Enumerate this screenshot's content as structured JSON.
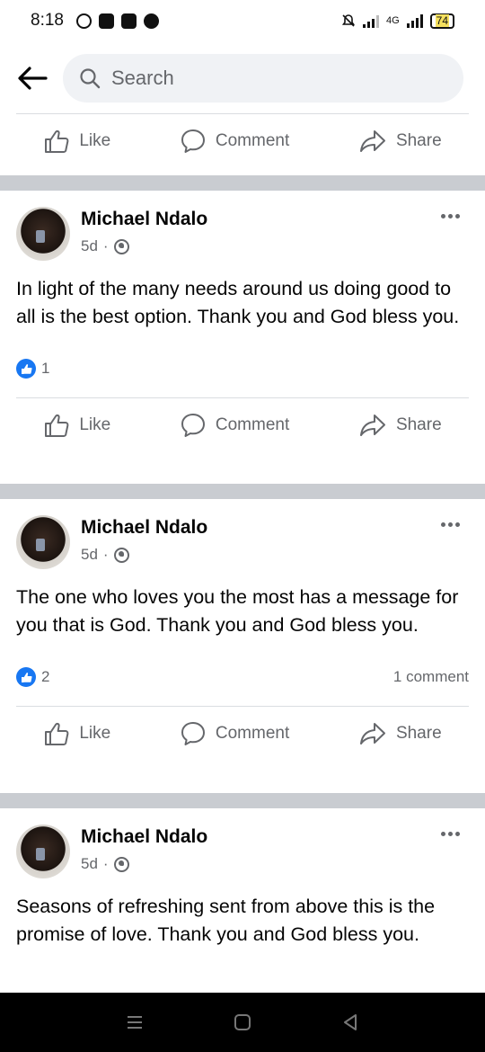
{
  "status": {
    "time": "8:18",
    "network": "4G",
    "battery": "74"
  },
  "search": {
    "placeholder": "Search"
  },
  "actions": {
    "like": "Like",
    "comment": "Comment",
    "share": "Share"
  },
  "posts": [
    {
      "author": "Michael Ndalo",
      "time": "5d",
      "text": "In light of the many needs around us doing good to all is the best option. Thank you and God bless you.",
      "likes": "1",
      "comments": ""
    },
    {
      "author": "Michael Ndalo",
      "time": "5d",
      "text": "The one who loves you the most has a message for you that is God.  Thank you and God bless you.",
      "likes": "2",
      "comments": "1 comment"
    },
    {
      "author": "Michael Ndalo",
      "time": "5d",
      "text": "Seasons of refreshing sent from above this is the promise of love. Thank you and God bless you.",
      "likes": "",
      "comments": ""
    }
  ],
  "icons": [
    "back-arrow-icon",
    "search-icon",
    "like-icon",
    "comment-icon",
    "share-icon",
    "globe-icon",
    "more-icon",
    "like-reaction-icon",
    "recents-icon",
    "home-icon",
    "back-nav-icon"
  ],
  "colors": {
    "accent": "#1877f2",
    "muted": "#65676b",
    "separator": "#c9ccd1",
    "search_bg": "#f0f2f5"
  }
}
